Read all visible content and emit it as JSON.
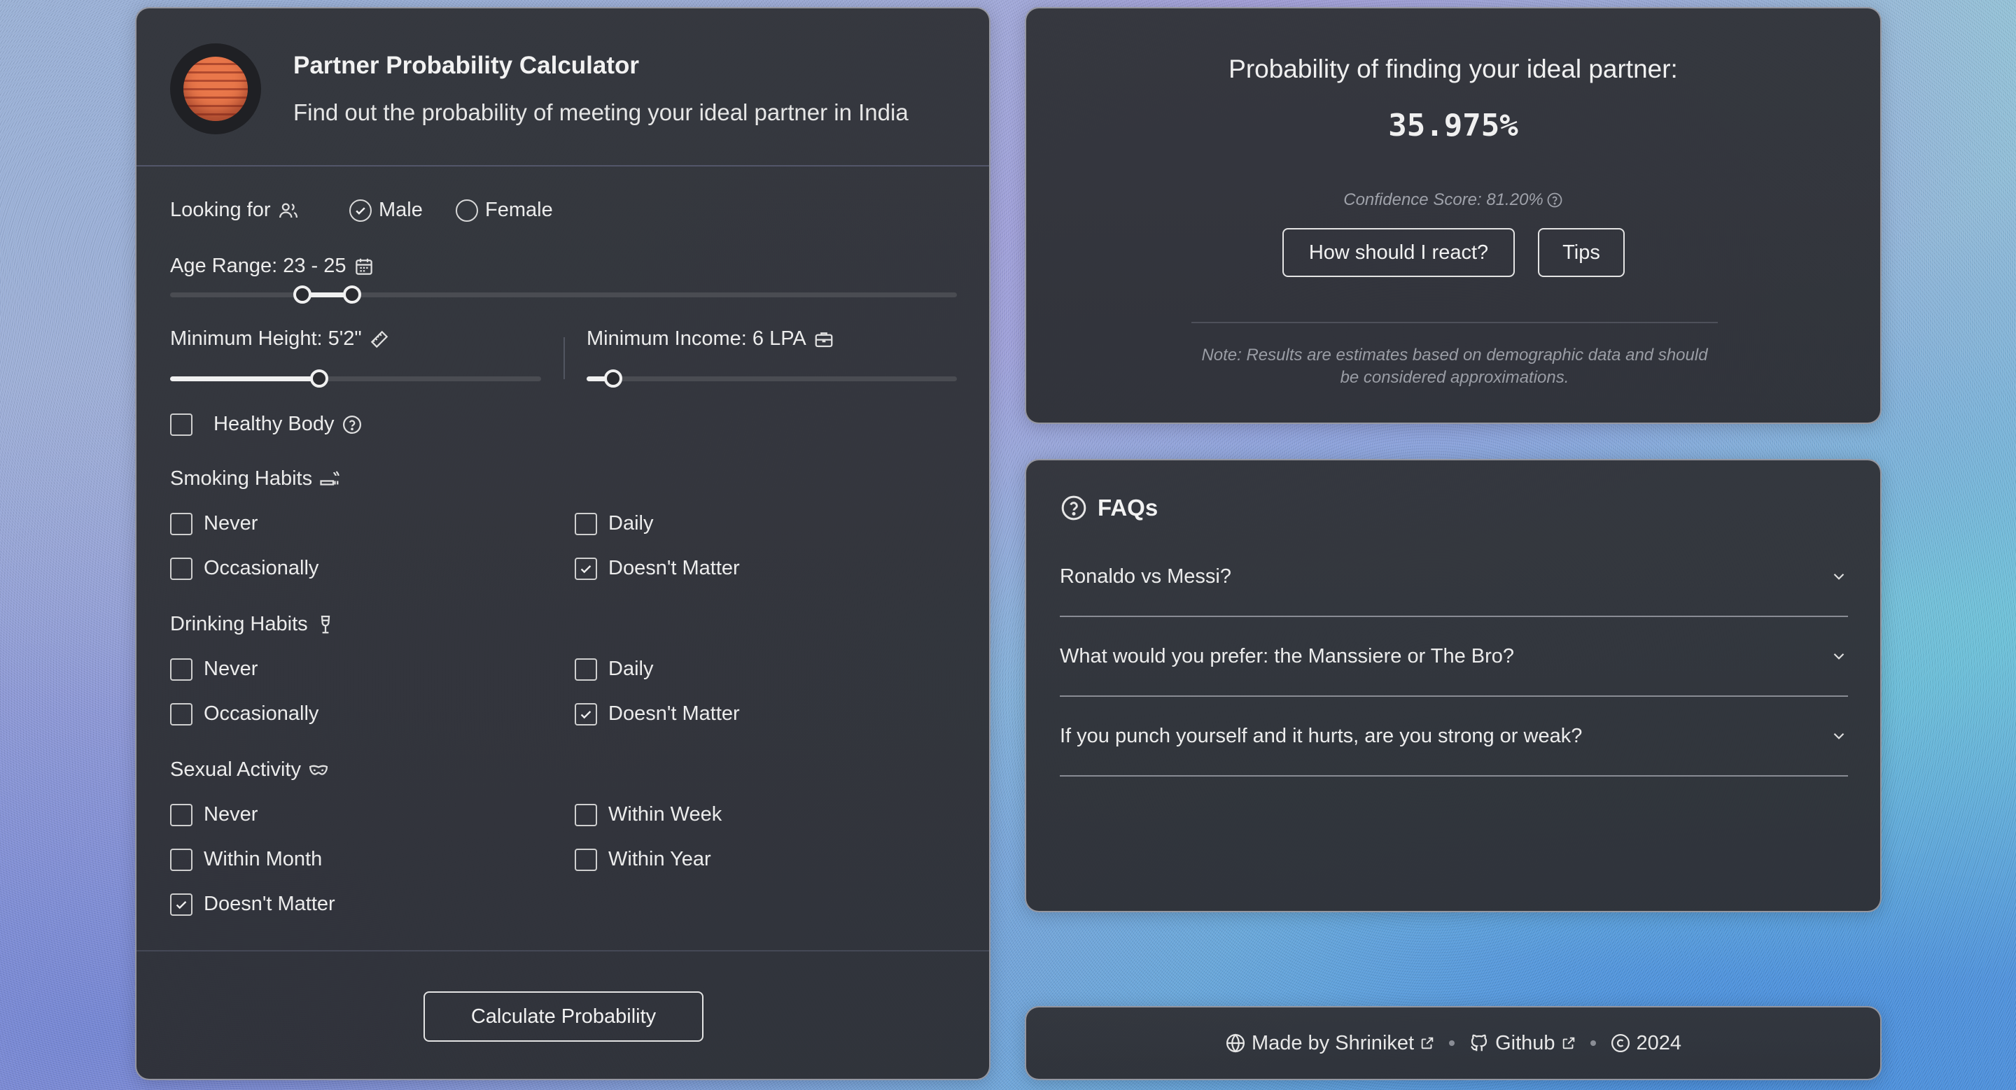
{
  "header": {
    "title": "Partner Probability Calculator",
    "subtitle": "Find out the probability of meeting your ideal partner in India"
  },
  "form": {
    "looking_for": {
      "label": "Looking for",
      "options": [
        "Male",
        "Female"
      ],
      "selected": "Male"
    },
    "age": {
      "label": "Age Range: 23 - 25",
      "min_value": 23,
      "max_value": 25
    },
    "height": {
      "label": "Minimum Height: 5'2\"",
      "value": "5'2\""
    },
    "income": {
      "label": "Minimum Income: 6 LPA",
      "value": "6 LPA"
    },
    "healthy_body": {
      "label": "Healthy Body",
      "checked": false
    },
    "smoking": {
      "label": "Smoking Habits",
      "options": [
        "Never",
        "Daily",
        "Occasionally",
        "Doesn't Matter"
      ],
      "checked": [
        "Doesn't Matter"
      ]
    },
    "drinking": {
      "label": "Drinking Habits",
      "options": [
        "Never",
        "Daily",
        "Occasionally",
        "Doesn't Matter"
      ],
      "checked": [
        "Doesn't Matter"
      ]
    },
    "sexual": {
      "label": "Sexual Activity",
      "options": [
        "Never",
        "Within Week",
        "Within Month",
        "Within Year",
        "Doesn't Matter"
      ],
      "checked": [
        "Doesn't Matter"
      ]
    },
    "calculate_label": "Calculate Probability"
  },
  "result": {
    "heading": "Probability of finding your ideal partner:",
    "value": "35.975%",
    "confidence": "Confidence Score: 81.20%",
    "react_label": "How should I react?",
    "tips_label": "Tips",
    "note": "Note: Results are estimates based on demographic data and should be considered approximations."
  },
  "faq": {
    "title": "FAQs",
    "items": [
      "Ronaldo vs Messi?",
      "What would you prefer: the Manssiere or The Bro?",
      "If you punch yourself and it hurts, are you strong or weak?"
    ]
  },
  "footer": {
    "made_by": "Made by Shriniket",
    "github": "Github",
    "copyright": "2024"
  },
  "colors": {
    "card_bg": "#323439",
    "accent_text": "#ececec",
    "muted": "#9fa2aa"
  }
}
